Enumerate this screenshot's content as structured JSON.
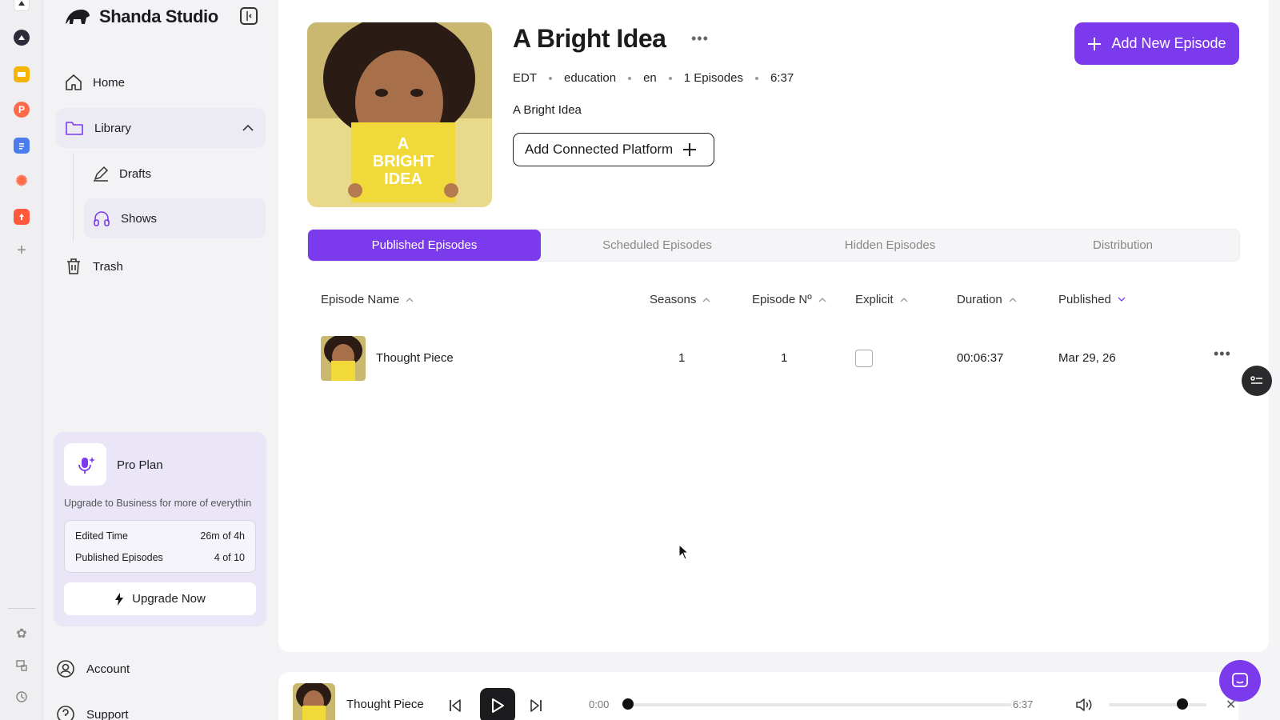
{
  "brand": {
    "name": "Shanda Studio"
  },
  "sidebar": {
    "items": [
      {
        "label": "Home"
      },
      {
        "label": "Library"
      },
      {
        "label": "Drafts"
      },
      {
        "label": "Shows"
      },
      {
        "label": "Trash"
      }
    ],
    "bottom": [
      {
        "label": "Account"
      },
      {
        "label": "Support"
      }
    ]
  },
  "plan": {
    "title": "Pro Plan",
    "description": "Upgrade to Business for more of everythin",
    "stats": [
      {
        "label": "Edited Time",
        "value": "26m of 4h"
      },
      {
        "label": "Published Episodes",
        "value": "4 of 10"
      }
    ],
    "upgrade_label": "Upgrade Now"
  },
  "show": {
    "title": "A Bright Idea",
    "meta": [
      "EDT",
      "education",
      "en",
      "1 Episodes",
      "6:37"
    ],
    "description": "A Bright Idea",
    "connect_label": "Add Connected Platform",
    "cover_text": [
      "A",
      "BRIGHT",
      "IDEA"
    ]
  },
  "actions": {
    "add_episode": "Add New Episode"
  },
  "tabs": [
    {
      "label": "Published Episodes"
    },
    {
      "label": "Scheduled Episodes"
    },
    {
      "label": "Hidden Episodes"
    },
    {
      "label": "Distribution"
    }
  ],
  "table": {
    "columns": [
      "Episode Name",
      "Seasons",
      "Episode Nº",
      "Explicit",
      "Duration",
      "Published"
    ],
    "rows": [
      {
        "name": "Thought Piece",
        "season": "1",
        "episode": "1",
        "explicit": false,
        "duration": "00:06:37",
        "published": "Mar 29, 26"
      }
    ]
  },
  "player": {
    "title": "Thought Piece",
    "current_time": "0:00",
    "total_time": "6:37",
    "progress": 0,
    "volume": 0.75
  },
  "colors": {
    "accent": "#7c3aed"
  }
}
